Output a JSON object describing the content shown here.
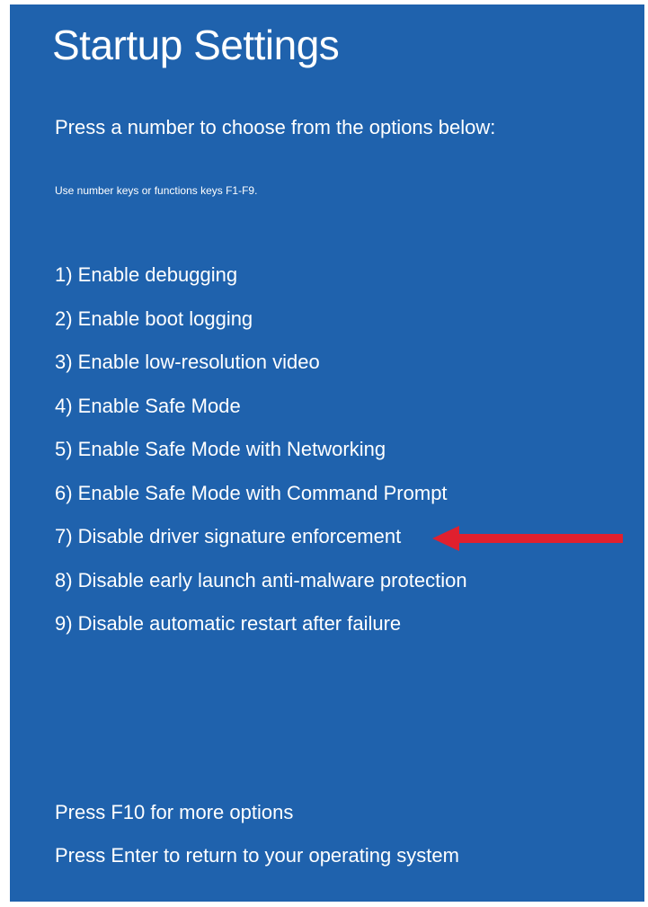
{
  "screen": {
    "title": "Startup Settings",
    "subtitle": "Press a number to choose from the options below:",
    "hint": "Use number keys or functions keys F1-F9."
  },
  "options": [
    "1) Enable debugging",
    "2) Enable boot logging",
    "3) Enable low-resolution video",
    "4) Enable Safe Mode",
    "5) Enable Safe Mode with Networking",
    "6) Enable Safe Mode with Command Prompt",
    "7) Disable driver signature enforcement",
    "8) Disable early launch anti-malware protection",
    "9) Disable automatic restart after failure"
  ],
  "footer": {
    "more_options": "Press F10 for more options",
    "return": "Press Enter to return to your operating system"
  },
  "colors": {
    "background": "#1f62ad",
    "text": "#ffffff",
    "arrow": "#e0202e"
  },
  "annotation": {
    "icon": "left-arrow-icon",
    "points_to_option": 7
  }
}
